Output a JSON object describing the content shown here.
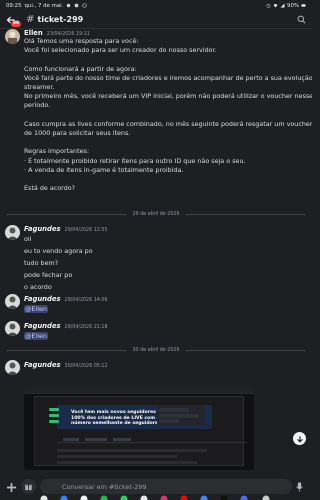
{
  "status_bar": {
    "time": "09:25",
    "date": "qui., 7 de mai.",
    "battery": "90%"
  },
  "header": {
    "unread_badge": "89",
    "channel_name": "ticket-299"
  },
  "messages": [
    {
      "author": "Ellen",
      "timestamp": "23/04/2026 19:11",
      "lines": [
        "Olá Temos uma resposta para você:",
        "Você foi selecionado para ser um creador do nosso servidor.",
        "",
        "Como funcionará a partir de agora:",
        "Você fará parte do nosso time de criadores e iremos acompanhar de perto a sua evolução como",
        "streamer.",
        "No primeiro mês, você receberá um VIP inicial, porém não poderá utilizar o voucher nesse",
        "período.",
        "",
        "Caso cumpra as lives conforme combinado, no mês seguinte poderá resgatar um voucher no valor",
        "de 1000 para solicitar seus itens.",
        "",
        "Regras importantes:",
        "· É totalmente proibido retirar itens para outro ID que não seja o seu.",
        "· A venda de itens in-game é totalmente proibida.",
        "",
        "Está de acordo?"
      ]
    },
    {
      "author": "Fagundes",
      "timestamp": "29/04/2026 12:55",
      "lines": [
        "oii",
        "eu to vendo agora po",
        "tudo bem?",
        "pode fechar po",
        "o acordo"
      ]
    },
    {
      "author": "Fagundes",
      "timestamp": "29/04/2026 14:06",
      "mention": "@Ellen"
    },
    {
      "author": "Fagundes",
      "timestamp": "29/04/2026 21:18",
      "mention": "@Ellen"
    },
    {
      "author": "Fagundes",
      "timestamp": "30/04/2026 05:12",
      "attachment": {
        "banner_text": "Você tem mais novos seguidores que 100% dos criadores de LIVE com um número semelhante de seguidores"
      }
    }
  ],
  "dividers": [
    "29 de abril de 2026",
    "30 de abril de 2026"
  ],
  "composer": {
    "placeholder": "Conversar em #ticket-299"
  },
  "colors": {
    "background": "#1e1f22",
    "mention_bg": "#3c4270",
    "badge": "#f23f42"
  }
}
